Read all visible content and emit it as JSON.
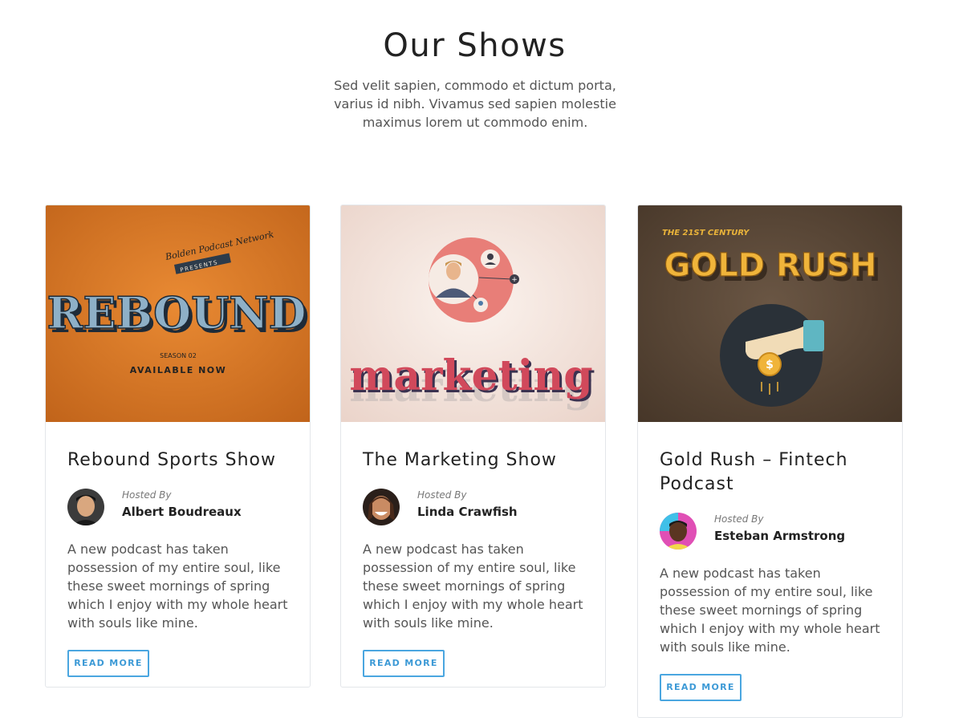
{
  "section": {
    "title": "Our Shows",
    "subtitle": "Sed velit sapien, commodo et dictum porta, varius id nibh. Vivamus sed sapien molestie maximus lorem ut commodo enim."
  },
  "shows": [
    {
      "cover": {
        "network": "Bolden Podcast Network",
        "presents": "PRESENTS",
        "headline": "REBOUND",
        "season": "SEASON 02",
        "tagline": "AVAILABLE NOW"
      },
      "title": "Rebound Sports Show",
      "hosted_by_label": "Hosted By",
      "host_name": "Albert Boudreaux",
      "description": "A new podcast has taken possession of my entire soul, like these sweet mornings of spring which I enjoy with my whole heart with souls like mine.",
      "button_label": "READ MORE"
    },
    {
      "cover": {
        "headline": "marketing"
      },
      "title": "The Marketing Show",
      "hosted_by_label": "Hosted By",
      "host_name": "Linda Crawfish",
      "description": "A new podcast has taken possession of my entire soul, like these sweet mornings of spring which I enjoy with my whole heart with souls like mine.",
      "button_label": "READ MORE"
    },
    {
      "cover": {
        "kicker": "THE 21ST CENTURY",
        "headline": "GOLD RUSH"
      },
      "title": "Gold Rush – Fintech Podcast",
      "hosted_by_label": "Hosted By",
      "host_name": "Esteban Armstrong",
      "description": "A new podcast has taken possession of my entire soul, like these sweet mornings of spring which I enjoy with my whole heart with souls like mine.",
      "button_label": "READ MORE"
    }
  ],
  "colors": {
    "accent": "#4aa6e0",
    "rebound_bg": "#d9761f",
    "marketing_bg": "#f3e2da",
    "goldrush_bg": "#5a4838"
  }
}
